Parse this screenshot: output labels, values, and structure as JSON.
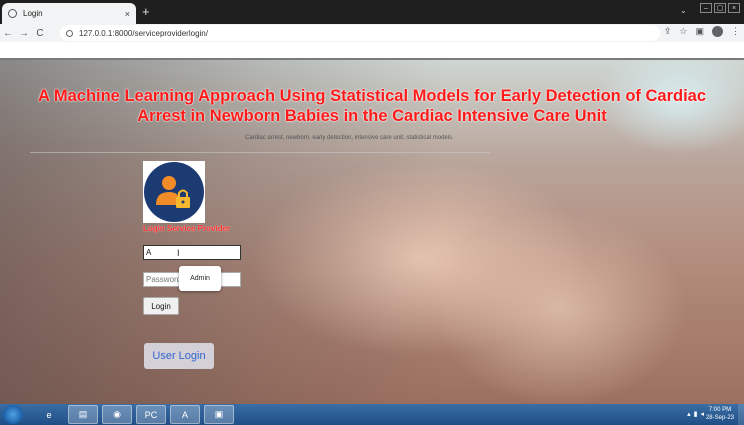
{
  "browser": {
    "tab_title": "Login",
    "tab_close": "×",
    "new_tab": "+",
    "url": "127.0.0.1:8000/serviceproviderlogin/",
    "back": "←",
    "forward": "→",
    "reload": "C"
  },
  "page": {
    "title": "A Machine Learning Approach Using Statistical Models for Early Detection of Cardiac Arrest in Newborn Babies in the Cardiac Intensive Care Unit",
    "subtitle": "Cardiac arrest, newborn, early detection, intensive care unit, statistical models",
    "login_heading": "Login Service Provider",
    "userid_value": "A",
    "password_placeholder": "Password",
    "autocomplete_suggestion": "Admin",
    "login_button": "Login",
    "user_login_link": "User Login"
  },
  "taskbar": {
    "apps": [
      "explorer-icon",
      "ie-icon",
      "folder-icon",
      "chrome-icon",
      "pycharm-icon",
      "pdf-icon",
      "window-icon"
    ],
    "clock_time": "7:00 PM",
    "clock_date": "28-Sep-23"
  }
}
